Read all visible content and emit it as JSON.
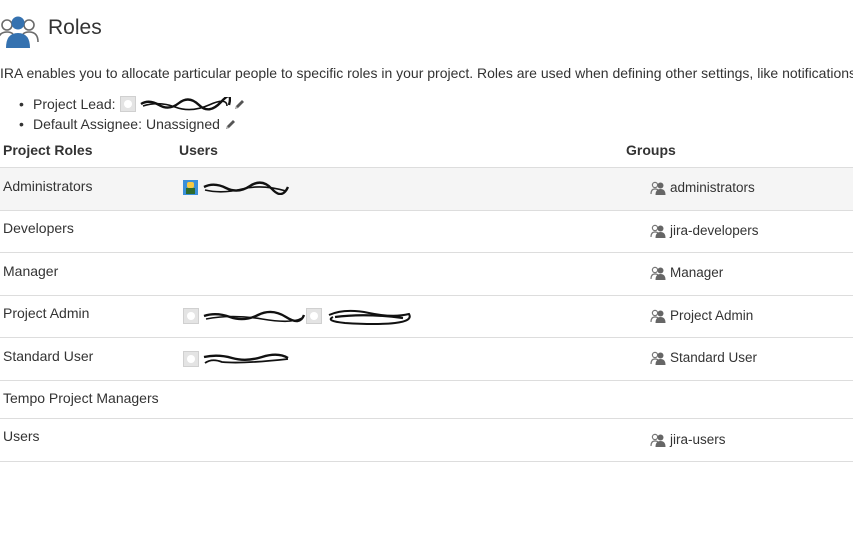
{
  "page": {
    "title": "Roles",
    "description": "IRA enables you to allocate particular people to specific roles in your project. Roles are used when defining other settings, like notifications"
  },
  "project_lead": {
    "label": "Project Lead:"
  },
  "default_assignee": {
    "label": "Default Assignee:",
    "value": "Unassigned"
  },
  "table": {
    "headers": {
      "roles": "Project Roles",
      "users": "Users",
      "groups": "Groups"
    },
    "rows": [
      {
        "role": "Administrators",
        "group": "administrators"
      },
      {
        "role": "Developers",
        "group": "jira-developers"
      },
      {
        "role": "Manager",
        "group": "Manager"
      },
      {
        "role": "Project Admin",
        "group": "Project Admin"
      },
      {
        "role": "Standard User",
        "group": "Standard User"
      },
      {
        "role": "Tempo Project Managers",
        "group": ""
      },
      {
        "role": "Users",
        "group": "jira-users"
      }
    ]
  },
  "icons": {
    "header": "roles-people-icon",
    "edit": "pencil-icon",
    "group": "group-icon",
    "avatar": "user-avatar-icon"
  }
}
